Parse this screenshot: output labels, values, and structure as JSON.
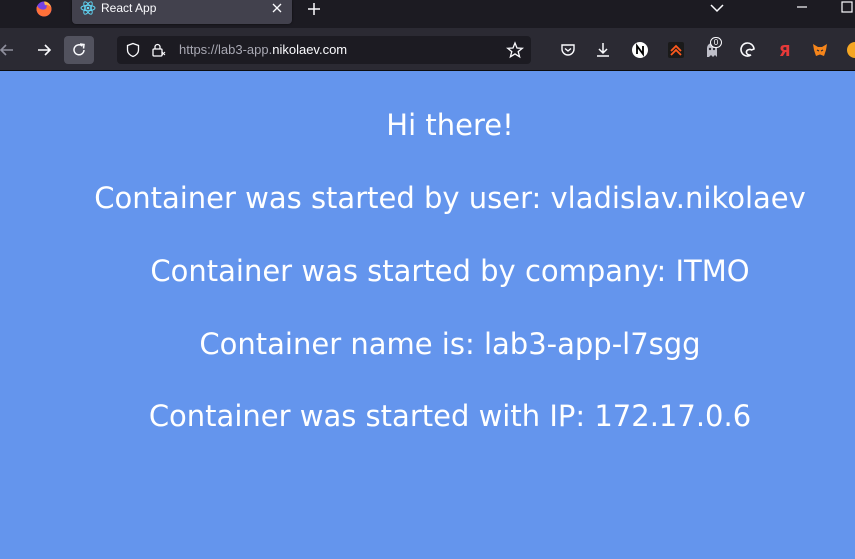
{
  "browser": {
    "tab": {
      "title": "React App",
      "favicon": "react-logo-icon"
    },
    "url": {
      "scheme_prefix": "https://lab3-app.",
      "host": "nikolaev.com"
    },
    "extension_badge": "0",
    "icons": [
      "firefox-logo-icon",
      "close-icon",
      "plus-icon",
      "chevron-down-icon",
      "minimize-icon",
      "maximize-icon",
      "back-icon",
      "forward-icon",
      "reload-icon",
      "shield-icon",
      "lock-icon",
      "star-icon",
      "pocket-icon",
      "download-icon",
      "notion-icon",
      "chevrons-up-icon",
      "extension-icon",
      "edge-icon",
      "yandex-icon",
      "metamask-icon",
      "overflow-icon"
    ]
  },
  "page": {
    "background": "#6495ed",
    "text_color": "#ffffff",
    "lines": [
      "Hi there!",
      "Container was started by user: vladislav.nikolaev",
      "Container was started by company: ITMO",
      "Container name is: lab3-app-l7sgg",
      "Container was started with IP: 172.17.0.6"
    ]
  }
}
